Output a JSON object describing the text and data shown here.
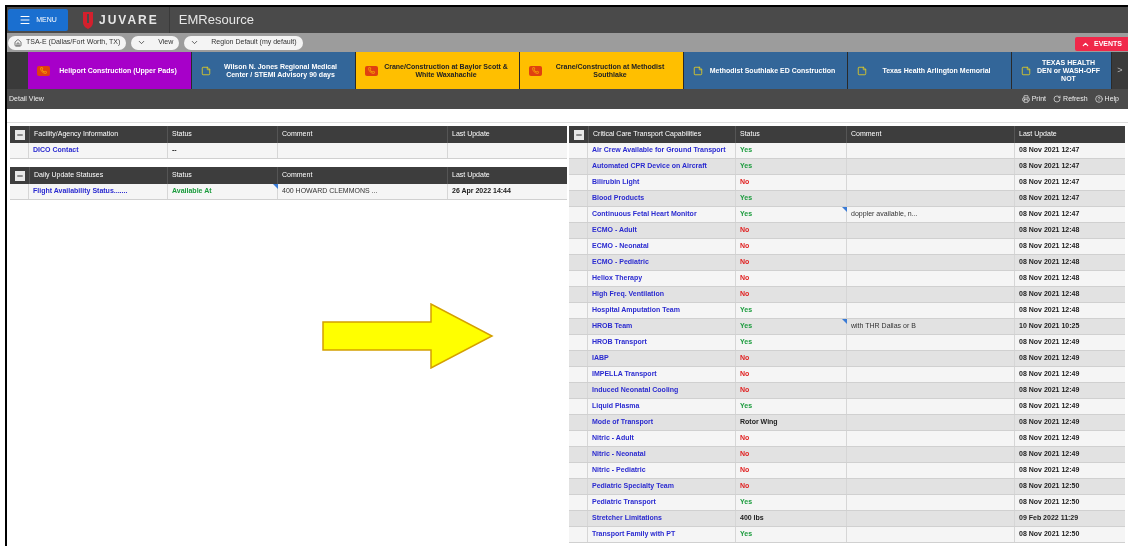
{
  "header": {
    "menu": "MENU",
    "brand": "JUVARE",
    "app": "EMResource"
  },
  "breadcrumbs": [
    {
      "kind": "home",
      "label": "TSA-E (Dallas/Fort Worth, TX)"
    },
    {
      "kind": "dropdown",
      "label": "View"
    },
    {
      "kind": "dropdown",
      "label": "Region Default (my default)"
    }
  ],
  "events_button": "EVENTS",
  "banners": [
    {
      "label": "Heliport Construction (Upper Pads)",
      "color": "#a700c9",
      "kind": "phone"
    },
    {
      "label": "Wilson N. Jones Regional Medical Center / STEMI Advisory 90 days",
      "color": "#336699",
      "kind": "note"
    },
    {
      "label": "Crane/Construction at Baylor Scott & White Waxahachie",
      "color": "#ffbf00",
      "kind": "phone"
    },
    {
      "label": "Crane/Construction at Methodist Southlake",
      "color": "#ffbf00",
      "kind": "phone"
    },
    {
      "label": "Methodist Southlake ED Construction",
      "color": "#336699",
      "kind": "note"
    },
    {
      "label": "Texas Health Arlington Memorial",
      "color": "#336699",
      "kind": "note"
    },
    {
      "label": "TEXAS HEALTH DEN or WASH-OFF NOT",
      "color": "#336699",
      "kind": "note"
    }
  ],
  "banner_next": ">",
  "detail_bar": {
    "title": "Detail View",
    "actions": [
      {
        "kind": "print",
        "label": "Print"
      },
      {
        "kind": "refresh",
        "label": "Refresh"
      },
      {
        "kind": "help",
        "label": "Help"
      }
    ]
  },
  "left_sections": [
    {
      "columns": [
        "Facility/Agency Information",
        "Status",
        "Comment",
        "Last Update"
      ],
      "expanded": true,
      "rows": [
        {
          "name": "DICO Contact",
          "status": "--",
          "kind": "plain",
          "comment": "",
          "flagged": false,
          "updated": ""
        }
      ]
    },
    {
      "columns": [
        "Daily Update Statuses",
        "Status",
        "Comment",
        "Last Update"
      ],
      "expanded": true,
      "rows": [
        {
          "name": "Flight Availability Status.......",
          "status": "Available At",
          "kind": "yes",
          "comment": "400 HOWARD CLEMMONS ...",
          "flagged": true,
          "updated": "26 Apr 2022 14:44"
        }
      ]
    }
  ],
  "right_section": {
    "columns": [
      "Critical Care Transport Capabilities",
      "Status",
      "Comment",
      "Last Update"
    ],
    "expanded": true,
    "rows": [
      {
        "name": "Air Crew Available for Ground Transport",
        "status": "Yes",
        "kind": "yes",
        "comment": "",
        "flagged": false,
        "updated": "08 Nov 2021 12:47"
      },
      {
        "name": "Automated CPR Device on Aircraft",
        "status": "Yes",
        "kind": "yes",
        "comment": "",
        "flagged": false,
        "updated": "08 Nov 2021 12:47"
      },
      {
        "name": "Bilirubin Light",
        "status": "No",
        "kind": "no",
        "comment": "",
        "flagged": false,
        "updated": "08 Nov 2021 12:47"
      },
      {
        "name": "Blood Products",
        "status": "Yes",
        "kind": "yes",
        "comment": "",
        "flagged": false,
        "updated": "08 Nov 2021 12:47"
      },
      {
        "name": "Continuous Fetal Heart Monitor",
        "status": "Yes",
        "kind": "yes",
        "comment": "doppler available, n...",
        "flagged": true,
        "updated": "08 Nov 2021 12:47"
      },
      {
        "name": "ECMO - Adult",
        "status": "No",
        "kind": "no",
        "comment": "",
        "flagged": false,
        "updated": "08 Nov 2021 12:48"
      },
      {
        "name": "ECMO - Neonatal",
        "status": "No",
        "kind": "no",
        "comment": "",
        "flagged": false,
        "updated": "08 Nov 2021 12:48"
      },
      {
        "name": "ECMO - Pediatric",
        "status": "No",
        "kind": "no",
        "comment": "",
        "flagged": false,
        "updated": "08 Nov 2021 12:48"
      },
      {
        "name": "Heliox Therapy",
        "status": "No",
        "kind": "no",
        "comment": "",
        "flagged": false,
        "updated": "08 Nov 2021 12:48"
      },
      {
        "name": "High Freq. Ventilation",
        "status": "No",
        "kind": "no",
        "comment": "",
        "flagged": false,
        "updated": "08 Nov 2021 12:48"
      },
      {
        "name": "Hospital Amputation Team",
        "status": "Yes",
        "kind": "yes",
        "comment": "",
        "flagged": false,
        "updated": "08 Nov 2021 12:48"
      },
      {
        "name": "HROB Team",
        "status": "Yes",
        "kind": "yes",
        "comment": "with THR Dallas or B",
        "flagged": true,
        "updated": "10 Nov 2021 10:25"
      },
      {
        "name": "HROB Transport",
        "status": "Yes",
        "kind": "yes",
        "comment": "",
        "flagged": false,
        "updated": "08 Nov 2021 12:49"
      },
      {
        "name": "IABP",
        "status": "No",
        "kind": "no",
        "comment": "",
        "flagged": false,
        "updated": "08 Nov 2021 12:49"
      },
      {
        "name": "IMPELLA Transport",
        "status": "No",
        "kind": "no",
        "comment": "",
        "flagged": false,
        "updated": "08 Nov 2021 12:49"
      },
      {
        "name": "Induced Neonatal Cooling",
        "status": "No",
        "kind": "no",
        "comment": "",
        "flagged": false,
        "updated": "08 Nov 2021 12:49"
      },
      {
        "name": "Liquid Plasma",
        "status": "Yes",
        "kind": "yes",
        "comment": "",
        "flagged": false,
        "updated": "08 Nov 2021 12:49"
      },
      {
        "name": "Mode of Transport",
        "status": "Rotor Wing",
        "kind": "plain",
        "comment": "",
        "flagged": false,
        "updated": "08 Nov 2021 12:49"
      },
      {
        "name": "Nitric - Adult",
        "status": "No",
        "kind": "no",
        "comment": "",
        "flagged": false,
        "updated": "08 Nov 2021 12:49"
      },
      {
        "name": "Nitric - Neonatal",
        "status": "No",
        "kind": "no",
        "comment": "",
        "flagged": false,
        "updated": "08 Nov 2021 12:49"
      },
      {
        "name": "Nitric - Pediatric",
        "status": "No",
        "kind": "no",
        "comment": "",
        "flagged": false,
        "updated": "08 Nov 2021 12:49"
      },
      {
        "name": "Pediatric Specialty Team",
        "status": "No",
        "kind": "no",
        "comment": "",
        "flagged": false,
        "updated": "08 Nov 2021 12:50"
      },
      {
        "name": "Pediatric Transport",
        "status": "Yes",
        "kind": "yes",
        "comment": "",
        "flagged": false,
        "updated": "08 Nov 2021 12:50"
      },
      {
        "name": "Stretcher Limitations",
        "status": "400 lbs",
        "kind": "plain",
        "comment": "",
        "flagged": false,
        "updated": "09 Feb 2022 11:29"
      },
      {
        "name": "Transport Family with PT",
        "status": "Yes",
        "kind": "yes",
        "comment": "",
        "flagged": false,
        "updated": "08 Nov 2021 12:50"
      }
    ]
  }
}
